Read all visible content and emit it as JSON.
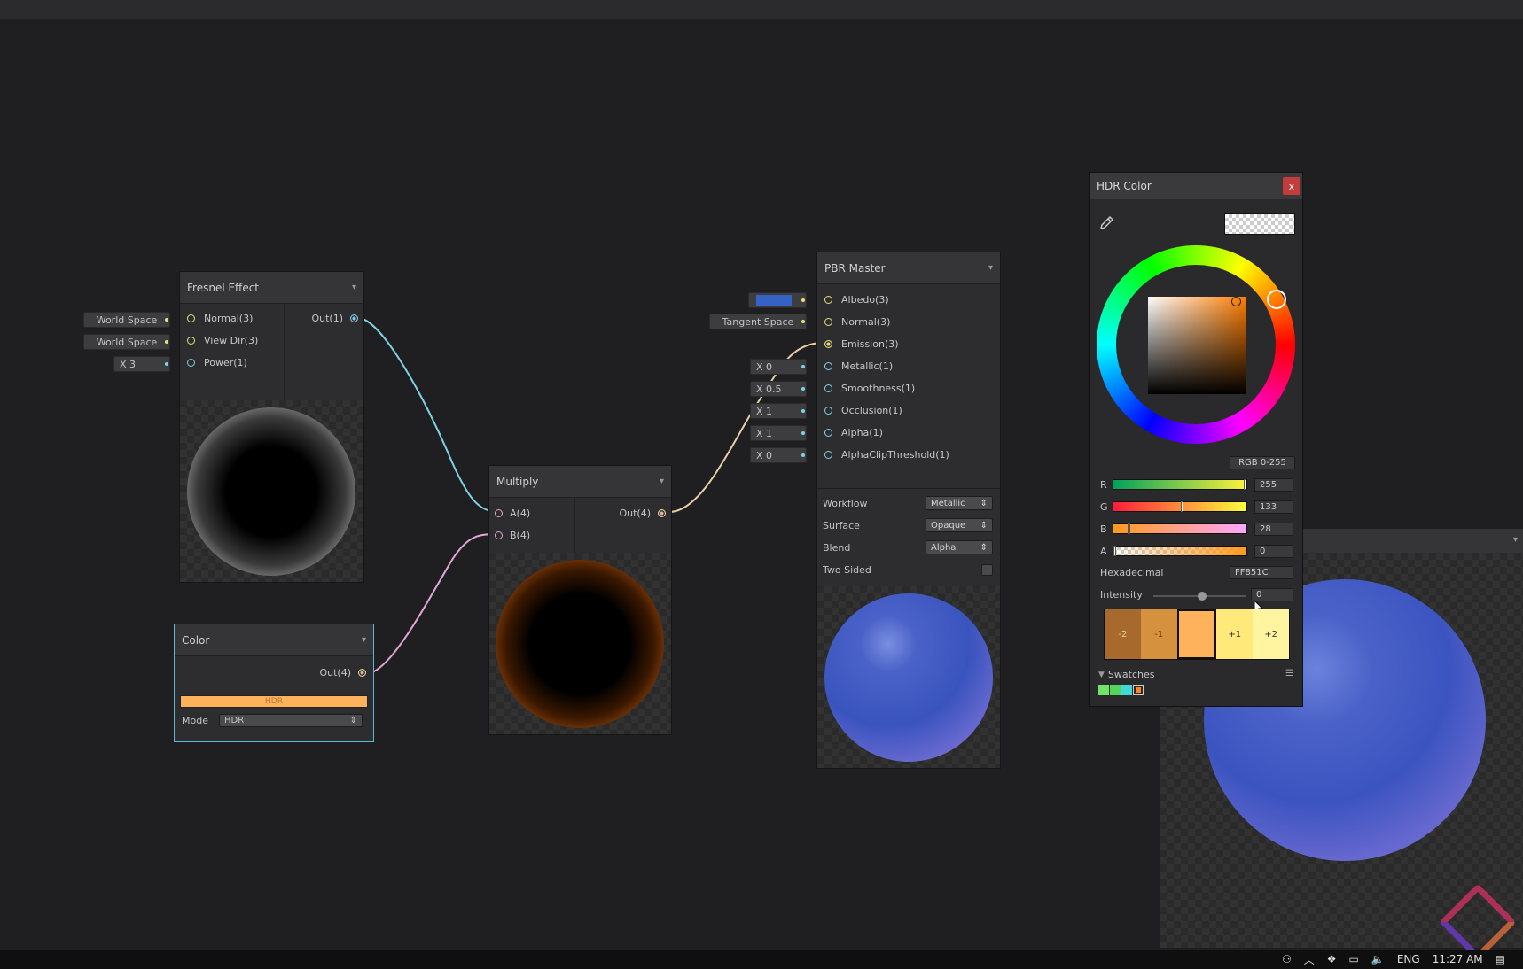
{
  "fresnel": {
    "title": "Fresnel Effect",
    "inputs": [
      "Normal(3)",
      "View Dir(3)",
      "Power(1)"
    ],
    "inlets": [
      "World Space",
      "World Space",
      "X  3"
    ],
    "output": "Out(1)"
  },
  "multiply": {
    "title": "Multiply",
    "inputs": [
      "A(4)",
      "B(4)"
    ],
    "output": "Out(4)"
  },
  "color_node": {
    "title": "Color",
    "output": "Out(4)",
    "swatch_label": "HDR",
    "mode_label": "Mode",
    "mode_value": "HDR"
  },
  "pbr": {
    "title": "PBR Master",
    "inputs": [
      "Albedo(3)",
      "Normal(3)",
      "Emission(3)",
      "Metallic(1)",
      "Smoothness(1)",
      "Occlusion(1)",
      "Alpha(1)",
      "AlphaClipThreshold(1)"
    ],
    "inlets": [
      "",
      "Tangent Space",
      "",
      "X  0",
      "X  0.5",
      "X  1",
      "X  1",
      "X  0"
    ],
    "props": [
      {
        "label": "Workflow",
        "value": "Metallic"
      },
      {
        "label": "Surface",
        "value": "Opaque"
      },
      {
        "label": "Blend",
        "value": "Alpha"
      },
      {
        "label": "Two Sided",
        "value": ""
      }
    ],
    "albedo_color": "#3563c4"
  },
  "picker": {
    "title": "HDR Color",
    "close": "x",
    "mode_button": "RGB 0-255",
    "channels": [
      {
        "label": "R",
        "value": "255",
        "fraction": 1.0
      },
      {
        "label": "G",
        "value": "133",
        "fraction": 0.52
      },
      {
        "label": "B",
        "value": "28",
        "fraction": 0.11
      },
      {
        "label": "A",
        "value": "0",
        "fraction": 0.0
      }
    ],
    "hex_label": "Hexadecimal",
    "hex_value": "FF851C",
    "intensity_label": "Intensity",
    "intensity_value": "0",
    "stops": [
      "-2",
      "-1",
      "",
      "+1",
      "+2"
    ],
    "swatches_label": "Swatches",
    "swatch_colors": [
      "#6fe36a",
      "#55d35a",
      "#3fd9d6"
    ],
    "color": "#FF851C"
  },
  "taskbar": {
    "lang": "ENG",
    "time": "11:27 AM"
  },
  "icons": {
    "eyedropper": "eyedropper-icon",
    "swatches_menu": "menu-icon"
  }
}
